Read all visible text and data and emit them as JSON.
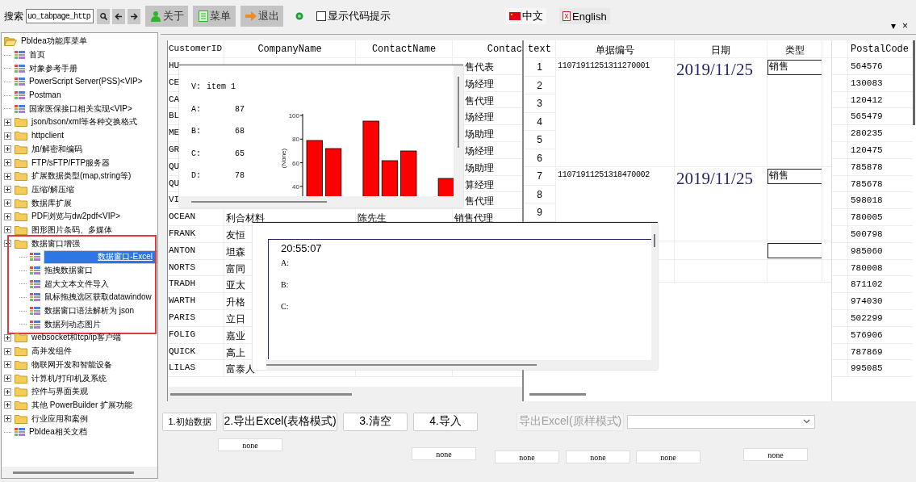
{
  "toolbar": {
    "search_label": "搜索",
    "search_value": "uo_tabpage_http",
    "buttons": [
      {
        "label": "关于"
      },
      {
        "label": "菜单"
      },
      {
        "label": "退出"
      }
    ],
    "code_hint": {
      "label": "显示代码提示",
      "checked": false
    },
    "languages": [
      {
        "label": "中文"
      },
      {
        "label": "English"
      }
    ]
  },
  "window_controls": [
    "▾",
    "×"
  ],
  "tree": {
    "label": "PbIdea功能库菜单",
    "kind": "folder",
    "expanded": true,
    "selected": false,
    "children": [
      {
        "label": "首页",
        "kind": "leaf",
        "selected": false
      },
      {
        "label": "对象参考手册",
        "kind": "leaf",
        "selected": false
      },
      {
        "label": "PowerScript Server(PSS)<VIP>",
        "kind": "leaf",
        "selected": false
      },
      {
        "label": "Postman",
        "kind": "leaf",
        "selected": false
      },
      {
        "label": "国家医保接口相关实现<VIP>",
        "kind": "leaf",
        "selected": false
      },
      {
        "label": "json/bson/xml等各种交换格式",
        "kind": "folder",
        "expanded": false,
        "selected": false
      },
      {
        "label": "httpclient",
        "kind": "folder",
        "expanded": false,
        "selected": false
      },
      {
        "label": "加/解密和编码",
        "kind": "folder",
        "expanded": false,
        "selected": false
      },
      {
        "label": "FTP/sFTP/FTP服务器",
        "kind": "folder",
        "expanded": false,
        "selected": false
      },
      {
        "label": "扩展数据类型(map,string等)",
        "kind": "folder",
        "expanded": false,
        "selected": false
      },
      {
        "label": "压缩/解压缩",
        "kind": "folder",
        "expanded": false,
        "selected": false
      },
      {
        "label": "数据库扩展",
        "kind": "folder",
        "expanded": false,
        "selected": false
      },
      {
        "label": "PDF浏览与dw2pdf<VIP>",
        "kind": "folder",
        "expanded": false,
        "selected": false
      },
      {
        "label": "图形图片条码、多媒体",
        "kind": "folder",
        "expanded": false,
        "selected": false
      },
      {
        "label": "数据窗口增强",
        "kind": "folder",
        "expanded": true,
        "selected": false,
        "highlighted": true,
        "children": [
          {
            "label": "数据窗口-Excel",
            "kind": "leaf",
            "selected": true
          },
          {
            "label": "拖拽数据窗口",
            "kind": "leaf",
            "selected": false
          },
          {
            "label": "超大文本文件导入",
            "kind": "leaf",
            "selected": false
          },
          {
            "label": "鼠标拖拽选区获取datawindow",
            "kind": "leaf",
            "selected": false
          },
          {
            "label": "数据窗口语法解析为 json",
            "kind": "leaf",
            "selected": false
          },
          {
            "label": "数据列动态图片",
            "kind": "leaf",
            "selected": false
          }
        ]
      },
      {
        "label": "websocket和tcp/ip客户端",
        "kind": "folder",
        "expanded": false,
        "selected": false
      },
      {
        "label": "高并发组件",
        "kind": "folder",
        "expanded": false,
        "selected": false
      },
      {
        "label": "物联网开发和智能设备",
        "kind": "folder",
        "expanded": false,
        "selected": false
      },
      {
        "label": "计算机/打印机及系统",
        "kind": "folder",
        "expanded": false,
        "selected": false
      },
      {
        "label": "控件与界面美观",
        "kind": "folder",
        "expanded": false,
        "selected": false
      },
      {
        "label": "其他 PowerBuilder 扩展功能",
        "kind": "folder",
        "expanded": false,
        "selected": false
      },
      {
        "label": "行业应用和案例",
        "kind": "folder",
        "expanded": false,
        "selected": false
      },
      {
        "label": "PbIdea相关文档",
        "kind": "leaf",
        "selected": false
      }
    ]
  },
  "customers": {
    "columns": [
      "CustomerID",
      "CompanyName",
      "ContactName",
      "Contac"
    ],
    "rows": [
      {
        "kind": "covered",
        "customer_id": "HU",
        "title": "售代表"
      },
      {
        "kind": "covered",
        "customer_id": "CE",
        "title": "场经理"
      },
      {
        "kind": "covered",
        "customer_id": "CA",
        "title": "售代理"
      },
      {
        "kind": "covered",
        "customer_id": "BL",
        "title": "场经理"
      },
      {
        "kind": "covered",
        "customer_id": "ME",
        "title": "场助理"
      },
      {
        "kind": "covered",
        "customer_id": "GR",
        "title": "场经理"
      },
      {
        "kind": "covered",
        "customer_id": "QU",
        "title": "场助理"
      },
      {
        "kind": "covered",
        "customer_id": "QU",
        "title": "算经理"
      },
      {
        "kind": "covered",
        "customer_id": "VI",
        "title": "售代理"
      },
      {
        "kind": "open",
        "customer_id": "OCEAN",
        "company": "利合材料",
        "contact": "陈先生",
        "title": "销售代理"
      },
      {
        "kind": "open",
        "customer_id": "FRANK",
        "company": "友恒"
      },
      {
        "kind": "open",
        "customer_id": "ANTON",
        "company": "坦森"
      },
      {
        "kind": "open",
        "customer_id": "NORTS",
        "company": "富同"
      },
      {
        "kind": "open",
        "customer_id": "TRADH",
        "company": "亚太"
      },
      {
        "kind": "open",
        "customer_id": "WARTH",
        "company": "升格"
      },
      {
        "kind": "open",
        "customer_id": "PARIS",
        "company": "立日"
      },
      {
        "kind": "open",
        "customer_id": "FOLIG",
        "company": "嘉业"
      },
      {
        "kind": "open",
        "customer_id": "QUICK",
        "company": "高上"
      },
      {
        "kind": "open",
        "customer_id": "LILAS",
        "company": "富泰人"
      }
    ]
  },
  "orders": {
    "columns": [
      "text",
      "单据编号",
      "日期",
      "类型"
    ],
    "groups": [
      {
        "kind": "record",
        "numbers": [
          "1",
          "2",
          "3",
          "4",
          "5",
          "6"
        ],
        "number": "11071911251311270001",
        "date": "2019/11/25",
        "type": "销售"
      },
      {
        "kind": "record",
        "numbers": [
          "7",
          "8",
          "9"
        ],
        "number": "11071911251318470002",
        "date": "2019/11/25",
        "type": "销售"
      },
      {
        "kind": "blank"
      }
    ]
  },
  "postal": {
    "column": "PostalCode",
    "values": [
      "564576",
      "130083",
      "120412",
      "565479",
      "280235",
      "120475",
      "785878",
      "785678",
      "598018",
      "780005",
      "500798",
      "985060",
      "780008",
      "871102",
      "974030",
      "502299",
      "576906",
      "787869",
      "995085"
    ]
  },
  "chart_popup": {
    "caption": "V:",
    "item": "item 1",
    "readings": [
      {
        "label": "A:",
        "value": "87"
      },
      {
        "label": "B:",
        "value": "68"
      },
      {
        "label": "C:",
        "value": "65"
      },
      {
        "label": "D:",
        "value": "78"
      }
    ],
    "chart": {
      "axis_label": "(None)",
      "axis_ticks": [
        "100",
        "80",
        "60",
        "40"
      ]
    }
  },
  "time_popup": {
    "time": "20:55:07",
    "labels": [
      "A:",
      "B:",
      "C:"
    ]
  },
  "actions": [
    {
      "label": "1.初始数据",
      "disabled": false
    },
    {
      "label": "2.导出Excel(表格模式)",
      "disabled": false
    },
    {
      "label": "3.清空",
      "disabled": false
    },
    {
      "label": "4.导入",
      "disabled": false
    },
    {
      "label": "导出Excel(原样模式)",
      "disabled": true
    }
  ],
  "none_buttons": [
    "none",
    "none",
    "none",
    "none",
    "none",
    "none"
  ]
}
